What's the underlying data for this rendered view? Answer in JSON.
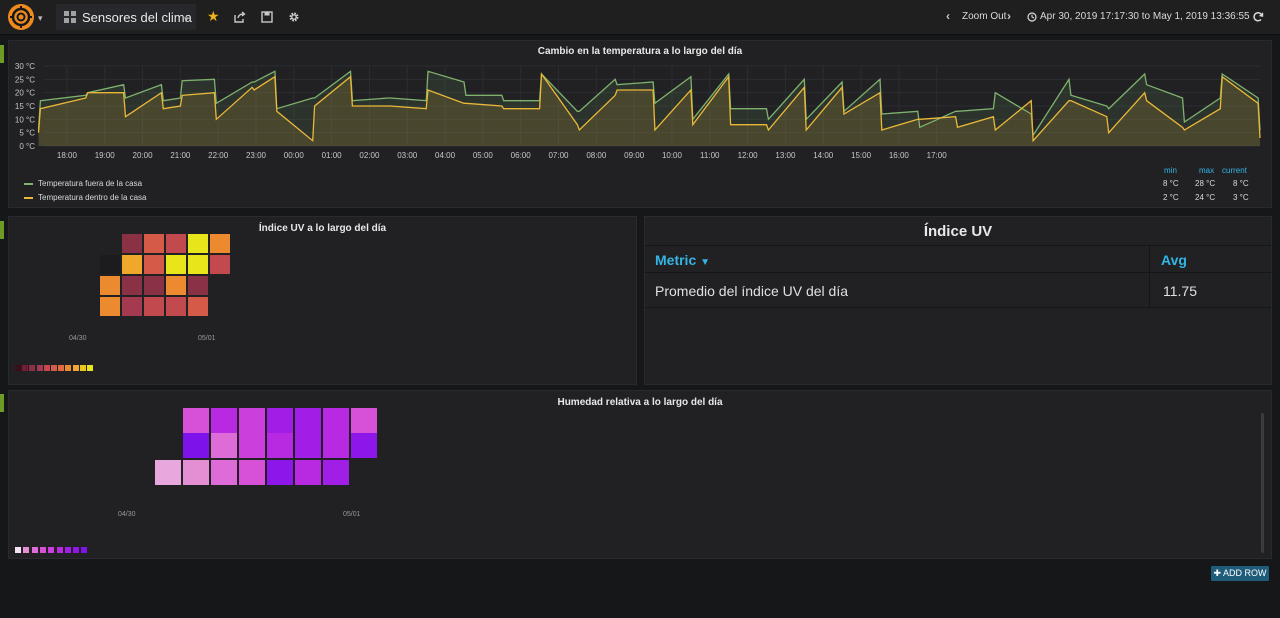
{
  "topbar": {
    "dashboard_title": "Sensores del clima",
    "zoom_out_label": "Zoom Out",
    "time_range": "Apr 30, 2019 17:17:30 to May 1, 2019 13:36:55"
  },
  "colors": {
    "outside_series": "#7eb26d",
    "inside_series": "#eab839",
    "link": "#33b5e5",
    "row_marker": "#6e9b25"
  },
  "temperature_panel": {
    "title": "Cambio en la temperatura a lo largo del día",
    "legend_headers": [
      "min",
      "max",
      "current"
    ],
    "legend": [
      {
        "name": "Temperatura fuera de la casa",
        "min": "8 °C",
        "max": "28 °C",
        "current": "8 °C"
      },
      {
        "name": "Temperatura dentro de la casa",
        "min": "2 °C",
        "max": "24 °C",
        "current": "3 °C"
      }
    ]
  },
  "uv_heatmap": {
    "title": "Índice UV a lo largo del día",
    "x_labels": [
      "04/30",
      "05/01"
    ],
    "legend_colors": [
      "#3a0f18",
      "#6e1f36",
      "#8a3146",
      "#a33a4f",
      "#c24a4e",
      "#d65a48",
      "#e06a3d",
      "#eb8a2f",
      "#f0a82a",
      "#ecc51f",
      "#e8e51a"
    ]
  },
  "uv_table": {
    "title": "Índice UV",
    "col_metric": "Metric",
    "col_avg": "Avg",
    "rows": [
      {
        "metric": "Promedio del índice UV del día",
        "avg": "11.75"
      }
    ]
  },
  "humidity_heatmap": {
    "title": "Humedad relativa a lo largo del día",
    "x_labels": [
      "04/30",
      "05/01"
    ],
    "legend_colors": [
      "#f2e4f5",
      "#e48fd4",
      "#dd6bd8",
      "#d650d8",
      "#cb3fdc",
      "#b82ae2",
      "#a11ee6",
      "#8c17e8",
      "#7d12ea"
    ]
  },
  "add_row_label": "ADD ROW",
  "chart_data": {
    "type": "line",
    "title": "Cambio en la temperatura a lo largo del día",
    "x_ticks": [
      "18:00",
      "19:00",
      "20:00",
      "21:00",
      "22:00",
      "23:00",
      "00:00",
      "01:00",
      "02:00",
      "03:00",
      "04:00",
      "05:00",
      "06:00",
      "07:00",
      "08:00",
      "09:00",
      "10:00",
      "11:00",
      "12:00",
      "13:00",
      "14:00",
      "15:00",
      "16:00",
      "17:00"
    ],
    "y_ticks": [
      "0 °C",
      "5 °C",
      "10 °C",
      "15 °C",
      "20 °C",
      "25 °C",
      "30 °C"
    ],
    "ylim": [
      0,
      30
    ],
    "unit": "°C",
    "series": [
      {
        "name": "Temperatura fuera de la casa",
        "points": [
          [
            17.25,
            6
          ],
          [
            17.3,
            17
          ],
          [
            18.5,
            19
          ],
          [
            18.55,
            20
          ],
          [
            19.5,
            23
          ],
          [
            19.55,
            18
          ],
          [
            20.5,
            23
          ],
          [
            20.55,
            17
          ],
          [
            21.0,
            18
          ],
          [
            21.05,
            24.5
          ],
          [
            21.9,
            25
          ],
          [
            21.95,
            16
          ],
          [
            22.9,
            24
          ],
          [
            22.95,
            24
          ],
          [
            23.5,
            28
          ],
          [
            23.55,
            14
          ],
          [
            24.5,
            18
          ],
          [
            24.55,
            18
          ],
          [
            25.5,
            28
          ],
          [
            25.55,
            17
          ],
          [
            26.5,
            18
          ],
          [
            26.55,
            18
          ],
          [
            27.5,
            17
          ],
          [
            27.55,
            28
          ],
          [
            28.5,
            24
          ],
          [
            28.55,
            19
          ],
          [
            29.5,
            19
          ],
          [
            29.55,
            17
          ],
          [
            30.5,
            17
          ],
          [
            30.55,
            27
          ],
          [
            31.5,
            13
          ],
          [
            31.55,
            13
          ],
          [
            32.5,
            25
          ],
          [
            32.55,
            23
          ],
          [
            33.5,
            24
          ],
          [
            33.55,
            16
          ],
          [
            34.5,
            26
          ],
          [
            34.55,
            10
          ],
          [
            35.5,
            27
          ],
          [
            35.55,
            14
          ],
          [
            36.5,
            14
          ],
          [
            36.55,
            10
          ],
          [
            37.5,
            25
          ],
          [
            37.55,
            10
          ],
          [
            38.5,
            24
          ],
          [
            38.55,
            13
          ],
          [
            39.5,
            25
          ],
          [
            39.55,
            12
          ],
          [
            40.5,
            13
          ],
          [
            40.55,
            7
          ],
          [
            41.5,
            13
          ],
          [
            41.55,
            13
          ],
          [
            42.5,
            14
          ],
          [
            42.55,
            20
          ],
          [
            43.5,
            12
          ],
          [
            43.55,
            4
          ],
          [
            44.5,
            25
          ],
          [
            44.55,
            19
          ],
          [
            45.5,
            15
          ],
          [
            45.55,
            14
          ],
          [
            46.5,
            27
          ],
          [
            46.55,
            23
          ],
          [
            47.5,
            18
          ],
          [
            47.55,
            9
          ],
          [
            48.5,
            18
          ],
          [
            48.55,
            27
          ],
          [
            49.5,
            18
          ],
          [
            49.55,
            6
          ]
        ]
      },
      {
        "name": "Temperatura dentro de la casa",
        "points": [
          [
            17.25,
            5
          ],
          [
            17.3,
            14
          ],
          [
            18.5,
            18
          ],
          [
            18.55,
            20
          ],
          [
            19.5,
            20
          ],
          [
            19.55,
            11
          ],
          [
            20.5,
            20
          ],
          [
            20.55,
            14
          ],
          [
            21.0,
            15
          ],
          [
            21.05,
            19
          ],
          [
            21.9,
            20
          ],
          [
            21.95,
            10
          ],
          [
            22.9,
            22
          ],
          [
            22.95,
            21
          ],
          [
            23.5,
            26
          ],
          [
            23.55,
            13
          ],
          [
            24.5,
            2
          ],
          [
            24.55,
            15
          ],
          [
            25.5,
            26
          ],
          [
            25.55,
            15
          ],
          [
            26.5,
            15
          ],
          [
            26.55,
            15
          ],
          [
            27.5,
            14
          ],
          [
            27.55,
            21
          ],
          [
            28.5,
            16
          ],
          [
            28.55,
            16
          ],
          [
            29.5,
            15
          ],
          [
            29.55,
            14
          ],
          [
            30.5,
            14
          ],
          [
            30.55,
            27
          ],
          [
            31.5,
            8
          ],
          [
            31.55,
            6
          ],
          [
            32.5,
            19
          ],
          [
            32.55,
            21
          ],
          [
            33.5,
            21
          ],
          [
            33.55,
            6
          ],
          [
            34.5,
            21
          ],
          [
            34.55,
            8
          ],
          [
            35.5,
            26
          ],
          [
            35.55,
            8
          ],
          [
            36.5,
            8
          ],
          [
            36.55,
            6
          ],
          [
            37.5,
            22
          ],
          [
            37.55,
            6
          ],
          [
            38.5,
            22
          ],
          [
            38.55,
            12
          ],
          [
            39.5,
            20
          ],
          [
            39.55,
            6
          ],
          [
            40.5,
            10
          ],
          [
            40.55,
            10
          ],
          [
            41.5,
            11
          ],
          [
            41.55,
            7
          ],
          [
            42.5,
            11
          ],
          [
            42.55,
            6
          ],
          [
            43.5,
            17
          ],
          [
            43.55,
            2
          ],
          [
            44.5,
            17
          ],
          [
            44.55,
            17
          ],
          [
            45.5,
            11
          ],
          [
            45.55,
            5
          ],
          [
            46.5,
            20
          ],
          [
            46.55,
            17
          ],
          [
            47.5,
            7
          ],
          [
            47.55,
            6
          ],
          [
            48.5,
            14
          ],
          [
            48.55,
            26
          ],
          [
            49.5,
            16
          ],
          [
            49.55,
            3
          ]
        ]
      }
    ]
  }
}
